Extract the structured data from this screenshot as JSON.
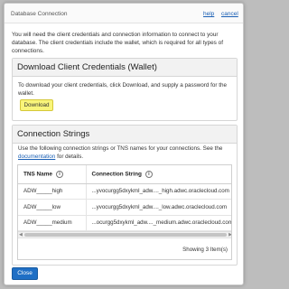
{
  "dialog": {
    "title": "Database Connection",
    "help_label": "help",
    "cancel_label": "cancel",
    "intro": "You will need the client credentials and connection information to connect to your database. The client credentials include the wallet, which is required for all types of connections."
  },
  "wallet_section": {
    "heading": "Download Client Credentials (Wallet)",
    "description": "To download your client credentials, click Download, and supply a password for the wallet.",
    "download_label": "Download",
    "download_color": "#f9f57a"
  },
  "conn_section": {
    "heading": "Connection Strings",
    "text_before": "Use the following connection strings or TNS names for your connections. See the",
    "doc_link": "documentation",
    "text_after": "for details.",
    "columns": [
      "TNS Name",
      "Connection String"
    ],
    "rows": [
      {
        "tns": "ADW_____high",
        "conn": "...yvocurgg5dxykml_adw...._high.adwc.oraclecloud.com"
      },
      {
        "tns": "ADW_____low",
        "conn": "...yvocurgg5dxykml_adw...._low.adwc.oraclecloud.com"
      },
      {
        "tns": "ADW_____medium",
        "conn": "...ocurgg5dxykml_adw...._medium.adwc.oraclecloud.com"
      }
    ],
    "showing": "Showing 3 Item(s)"
  },
  "footer": {
    "close_label": "Close",
    "close_color": "#1f6fc5"
  },
  "icons": [
    "info-icon",
    "info-icon"
  ]
}
